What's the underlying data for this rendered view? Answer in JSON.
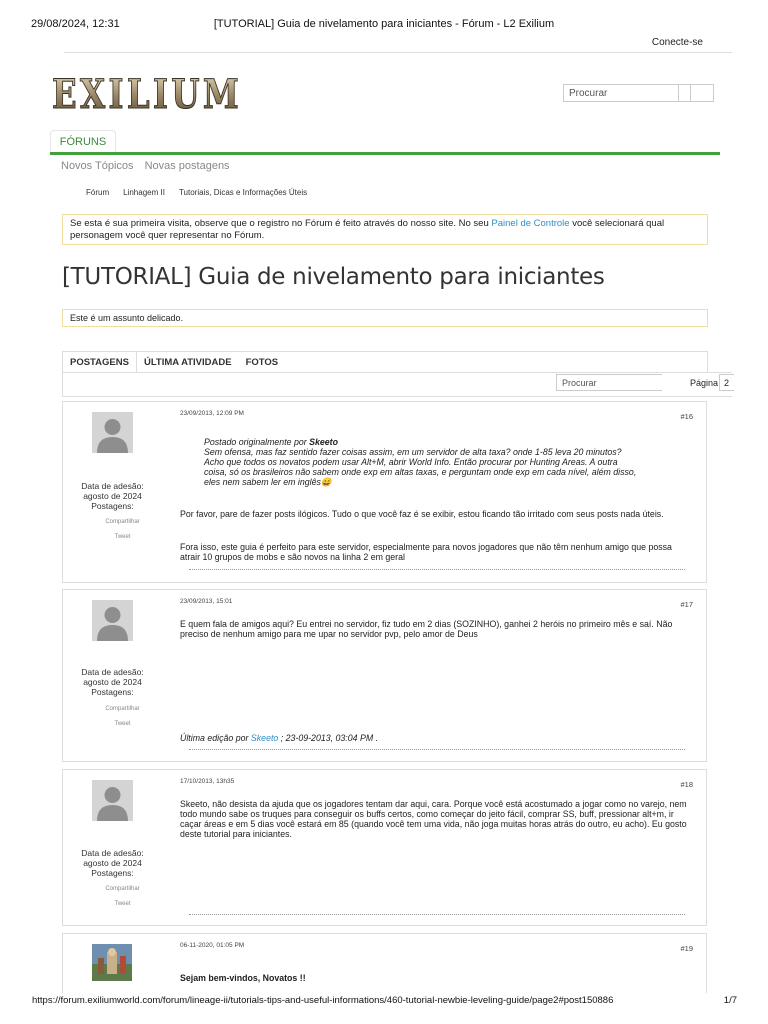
{
  "print_header": {
    "datetime": "29/08/2024, 12:31",
    "doc_title": "[TUTORIAL] Guia de nivelamento para iniciantes - Fórum - L2 Exilium"
  },
  "header": {
    "login": "Conecte-se",
    "logo_text": "EXILIUM",
    "search_placeholder": "Procurar"
  },
  "nav": {
    "forums_tab": "FÓRUNS",
    "sub": [
      "Novos Tópicos",
      "Novas postagens"
    ]
  },
  "breadcrumb": [
    "Fórum",
    "Linhagem II",
    "Tutoriais, Dicas e Informações Úteis"
  ],
  "notice": {
    "before": "Se esta é sua primeira visita, observe que o registro no Fórum é feito através do nosso site. No seu ",
    "link": "Painel de Controle",
    "after": " você selecionará qual personagem você quer representar no Fórum."
  },
  "thread": {
    "title": "[TUTORIAL] Guia de nivelamento para iniciantes",
    "delicate": "Este é um assunto delicado."
  },
  "tabs": [
    "POSTAGENS",
    "ÚLTIMA ATIVIDADE",
    "FOTOS"
  ],
  "toolbar": {
    "search_placeholder": "Procurar",
    "page_label": "Página",
    "page_number": "2"
  },
  "user_labels": {
    "joined": "Data de adesão:",
    "join_date": "agosto de 2024",
    "posts": "Postagens:",
    "share": "Compartilhar",
    "tweet": "Tweet"
  },
  "posts": [
    {
      "date": "23/09/2013, 12:09 PM",
      "number": "#16",
      "quote_by_prefix": "Postado originalmente por ",
      "quote_author": "Skeeto",
      "quote_lines": [
        "Sem ofensa, mas faz sentido fazer coisas assim, em um servidor de alta taxa? onde 1-85 leva 20 minutos?",
        "Acho que todos os novatos podem usar Alt+M, abrir World Info. Então procurar por Hunting Areas. A outra",
        "coisa, só os brasileiros não sabem onde exp em altas taxas, e perguntam onde exp em cada nível, além disso,",
        "eles nem sabem ler em inglês"
      ],
      "emoji": "😄",
      "paragraphs": [
        "Por favor, pare de fazer posts ilógicos. Tudo o que você faz é se exibir, estou ficando tão irritado com seus posts nada úteis.",
        "Fora isso, este guia é perfeito para este servidor, especialmente para novos jogadores que não têm nenhum amigo que possa atrair 10 grupos de mobs e são novos na linha 2 em geral"
      ]
    },
    {
      "date": "23/09/2013, 15:01",
      "number": "#17",
      "paragraphs": [
        "E quem fala de amigos aqui? Eu entrei no servidor, fiz tudo em 2 dias (SOZINHO), ganhei 2 heróis no primeiro mês e saí. Não preciso de nenhum amigo para me upar no servidor pvp, pelo amor de Deus"
      ],
      "edit_prefix": "Última edição por ",
      "edit_author": "Skeeto",
      "edit_suffix": " ; 23-09-2013, 03:04 PM ."
    },
    {
      "date": "17/10/2013, 13h35",
      "number": "#18",
      "paragraphs": [
        "Skeeto, não desista da ajuda que os jogadores tentam dar aqui, cara. Porque você está acostumado a jogar como no varejo, nem todo mundo sabe os truques para conseguir os buffs certos, como começar do jeito fácil, comprar SS, buff, pressionar alt+m, ir caçar áreas e em 5 dias você estará em 85 (quando você tem uma vida, não joga muitas horas atrás do outro, eu acho). Eu gosto deste tutorial para iniciantes."
      ]
    },
    {
      "date": "06-11-2020, 01:05 PM",
      "number": "#19",
      "paragraphs": [
        "Sejam bem-vindos, Novatos !!"
      ]
    }
  ],
  "print_footer": {
    "url": "https://forum.exiliumworld.com/forum/lineage-ii/tutorials-tips-and-useful-informations/460-tutorial-newbie-leveling-guide/page2#post150886",
    "page": "1/7"
  },
  "colors": {
    "accent_green": "#41a23b",
    "link_blue": "#2f8fc4",
    "notice_border": "#f0dea0"
  }
}
